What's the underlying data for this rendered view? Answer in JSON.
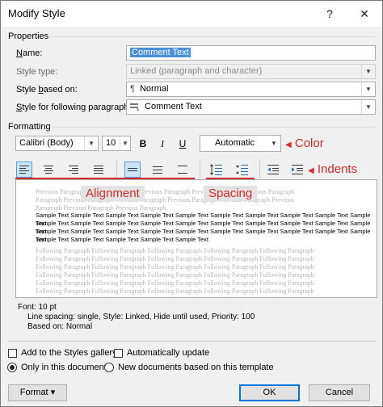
{
  "window": {
    "title": "Modify Style",
    "help_label": "?",
    "close_label": "✕"
  },
  "properties": {
    "group_label": "Properties",
    "name_label": "Name:",
    "name_value": "Comment Text",
    "style_type_label": "Style type:",
    "style_type_value": "Linked (paragraph and character)",
    "based_on_label": "Style based on:",
    "based_on_value": "Normal",
    "based_on_icon": "¶",
    "following_label": "Style for following paragraph:",
    "following_value": "Comment Text",
    "following_icon": "paragraph-style-icon"
  },
  "formatting": {
    "group_label": "Formatting",
    "font_name": "Calibri (Body)",
    "font_size": "10",
    "bold": "B",
    "italic": "I",
    "underline": "U",
    "color_value": "Automatic"
  },
  "callouts": {
    "color": "Color",
    "indents": "Indents",
    "alignment": "Alignment",
    "spacing": "Spacing",
    "accent_color": "#d12b2b"
  },
  "preview": {
    "previous_lines": [
      "Previous Paragraph Previous Paragraph Previous Paragraph Previous Paragraph Previous Paragraph",
      "Paragraph Previous Paragraph Previous Paragraph Previous Paragraph Previous Paragraph Previous",
      "Paragraph Previous Paragraph Previous Paragraph"
    ],
    "sample_lines": [
      "Sample Text Sample Text Sample Text Sample Text Sample Text Sample Text Sample Text Sample Text Sample Text Sample Text",
      "Sample Text Sample Text Sample Text Sample Text Sample Text Sample Text Sample Text Sample Text Sample Text Sample Text",
      "Sample Text Sample Text Sample Text Sample Text Sample Text Sample Text Sample Text Sample Text Sample Text Sample Text",
      "Sample Text Sample Text Sample Text Sample Text Sample Text"
    ],
    "following_lines": [
      "Following Paragraph Following Paragraph Following Paragraph Following Paragraph Following Paragraph",
      "Following Paragraph Following Paragraph Following Paragraph Following Paragraph Following Paragraph",
      "Following Paragraph Following Paragraph Following Paragraph Following Paragraph Following Paragraph",
      "Following Paragraph Following Paragraph Following Paragraph Following Paragraph Following Paragraph",
      "Following Paragraph Following Paragraph Following Paragraph Following Paragraph Following Paragraph",
      "Following Paragraph Following Paragraph Following Paragraph Following Paragraph Following Paragraph"
    ]
  },
  "description": {
    "line1": "Font: 10 pt",
    "line2": "Line spacing:  single, Style: Linked, Hide until used, Priority: 100",
    "line3": "Based on: Normal"
  },
  "options": {
    "add_to_gallery_label": "Add to the Styles gallery",
    "add_to_gallery_checked": false,
    "auto_update_label": "Automatically update",
    "auto_update_checked": false,
    "only_this_doc_label": "Only in this document",
    "only_this_doc_selected": true,
    "new_docs_label": "New documents based on this template",
    "new_docs_selected": false
  },
  "buttons": {
    "format": "Format",
    "format_arrow": "▾",
    "ok": "OK",
    "cancel": "Cancel"
  }
}
